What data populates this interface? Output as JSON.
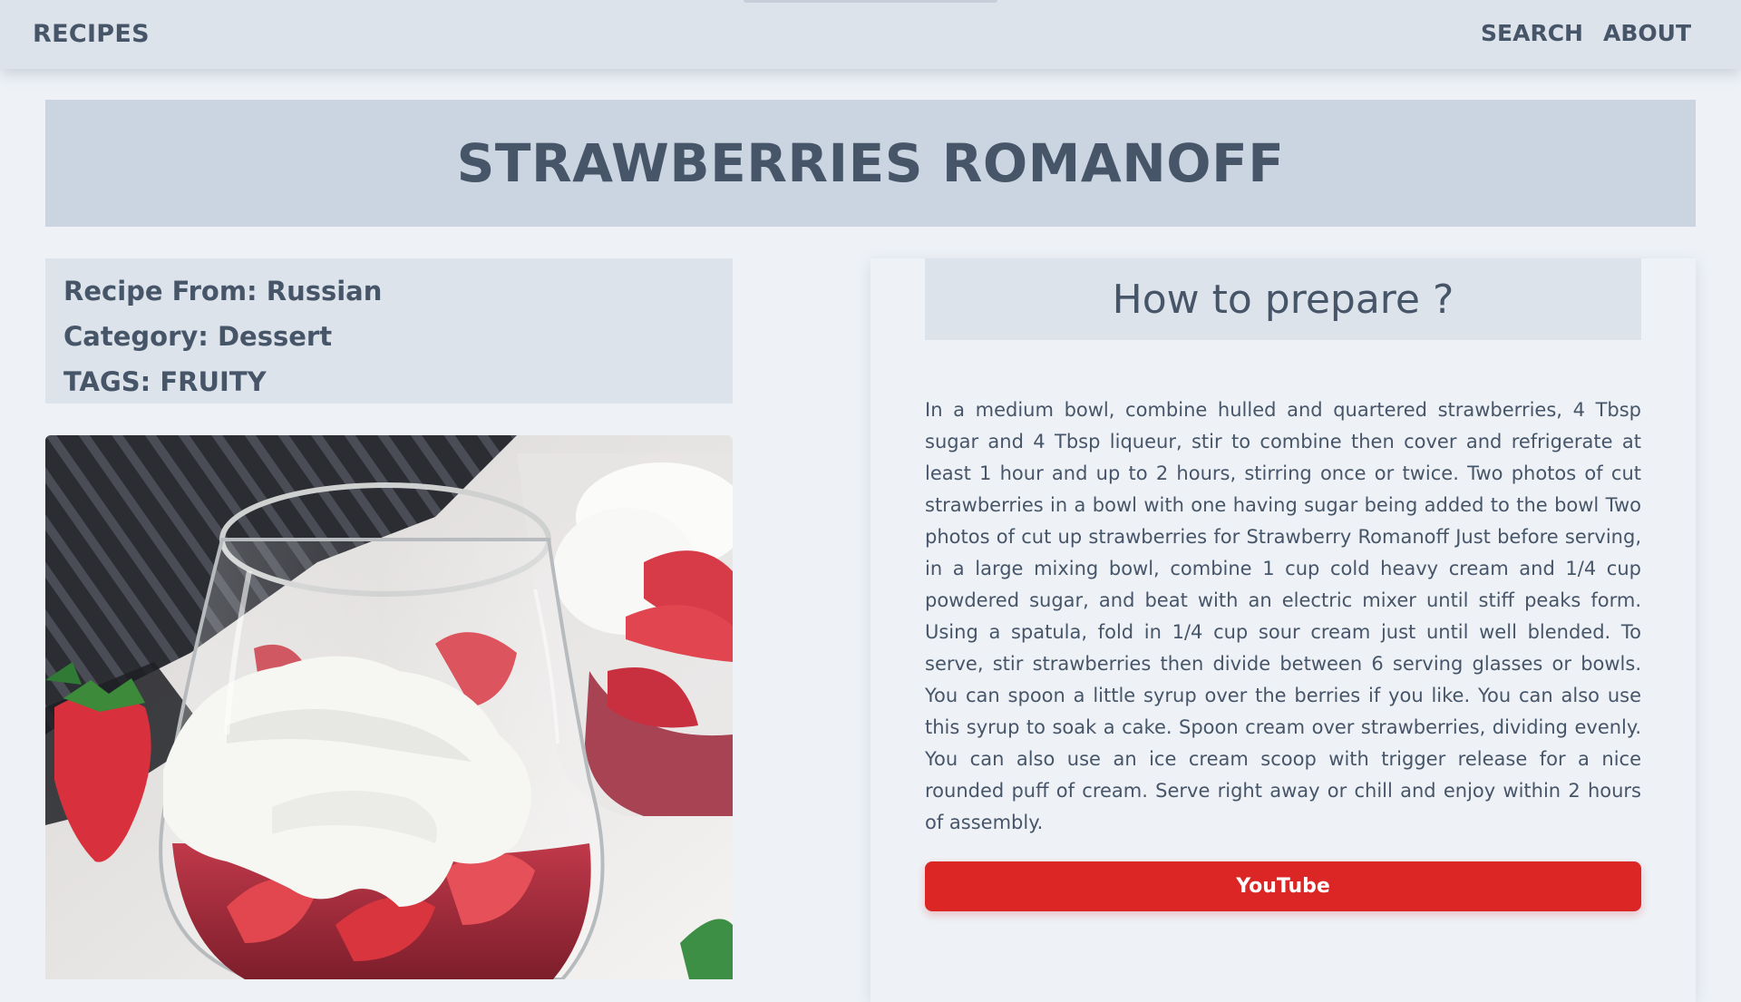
{
  "navbar": {
    "brand": "RECIPES",
    "links": [
      "SEARCH",
      "ABOUT"
    ]
  },
  "recipe": {
    "title": "STRAWBERRIES ROMANOFF",
    "origin_line": "Recipe From: Russian",
    "category_line": "Category: Dessert",
    "tags_line": "TAGS: FRUITY"
  },
  "preparation": {
    "heading": "How to prepare ?",
    "instructions": "In a medium bowl, combine hulled and quartered strawberries, 4 Tbsp sugar and 4 Tbsp liqueur, stir to combine then cover and refrigerate at least 1 hour and up to 2 hours, stirring once or twice. Two photos of cut strawberries in a bowl with one having sugar being added to the bowl Two photos of cut up strawberries for Strawberry Romanoff Just before serving, in a large mixing bowl, combine 1 cup cold heavy cream and 1/4 cup powdered sugar, and beat with an electric mixer until stiff peaks form. Using a spatula, fold in 1/4 cup sour cream just until well blended. To serve, stir strawberries then divide between 6 serving glasses or bowls. You can spoon a little syrup over the berries if you like. You can also use this syrup to soak a cake. Spoon cream over strawberries, dividing evenly. You can also use an ice cream scoop with trigger release for a nice rounded puff of cream. Serve right away or chill and enjoy within 2 hours of assembly.",
    "video_button": "YouTube"
  },
  "colors": {
    "navbar_bg": "#dde3eb",
    "banner_bg": "#cbd5e1",
    "text": "#475569",
    "youtube_red": "#dc2626"
  }
}
